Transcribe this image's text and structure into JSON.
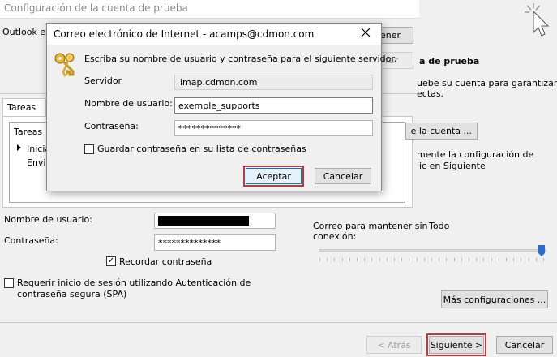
{
  "window": {
    "title": "Configuración de la cuenta de prueba"
  },
  "main": {
    "outlook_prefix": "Outlook es",
    "obtener_btn": "tener",
    "cerrar_btn": "rrar",
    "tab_label": "Tareas",
    "tasks_header": "Tareas",
    "task_1": "Inicia",
    "task_2": "Envia",
    "heading": "a de prueba",
    "desc_line1": "uebe su cuenta para garantizar",
    "desc_line2": "ectas.",
    "probar_btn": "e la cuenta ...",
    "note_line1": "mente la configuración de",
    "note_line2": "lic en Siguiente",
    "username_label": "Nombre de usuario:",
    "password_label": "Contraseña:",
    "password_value": "**************",
    "remember_label": "Recordar contraseña",
    "spa_line1": "Requerir inicio de sesión utilizando Autenticación de",
    "spa_line2": "contraseña segura (SPA)",
    "offline_label_line1": "Correo para mantener sin",
    "offline_label_line2": "conexión:",
    "offline_value": "Todo",
    "offline_slider_fraction": 1.0,
    "more_settings_btn": "Más configuraciones ...",
    "back_btn": "< Atrás",
    "next_btn": "Siguiente >",
    "cancel_btn": "Cancelar"
  },
  "dialog": {
    "title": "Correo electrónico de Internet - acamps@cdmon.com",
    "prompt": "Escriba su nombre de usuario y contraseña para el siguiente servidor.",
    "server_label": "Servidor",
    "server_value": "imap.cdmon.com",
    "username_label": "Nombre de usuario:",
    "username_value": "exemple_supports",
    "password_label": "Contraseña:",
    "password_value": "**************",
    "save_label": "Guardar contraseña en su lista de contraseñas",
    "accept_btn": "Aceptar",
    "cancel_btn": "Cancelar"
  },
  "colors": {
    "highlight": "#c0393b",
    "dialog_bg": "#f0f0f0",
    "slider_thumb": "#2a6cd6"
  }
}
